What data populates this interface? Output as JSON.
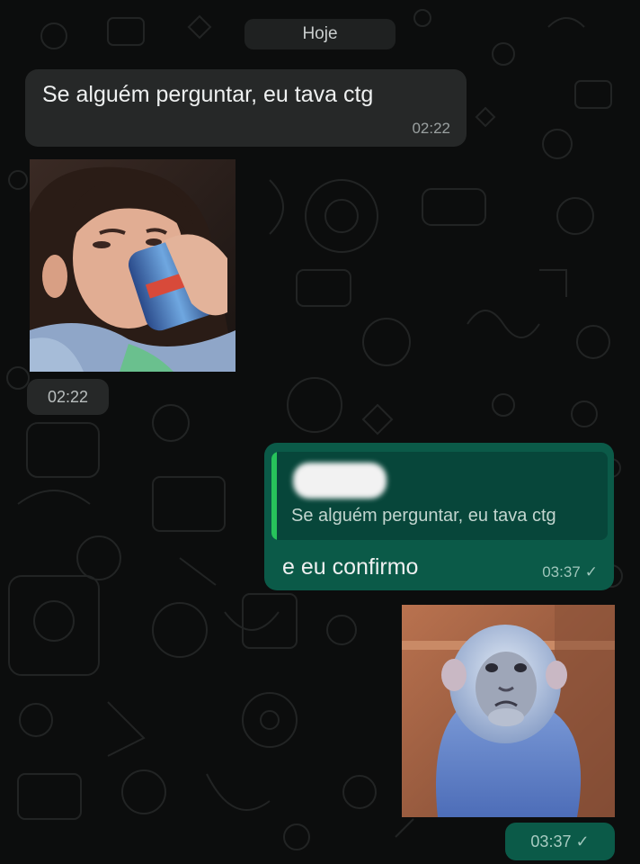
{
  "chat": {
    "date_separator": "Hoje",
    "messages": [
      {
        "direction": "incoming",
        "type": "text",
        "text": "Se alguém perguntar, eu tava ctg",
        "time": "02:22"
      },
      {
        "direction": "incoming",
        "type": "image",
        "time": "02:22"
      },
      {
        "direction": "outgoing",
        "type": "reply",
        "quoted_text": "Se alguém perguntar, eu tava ctg",
        "text": "e eu confirmo",
        "time": "03:37",
        "status_icon": "check-icon"
      },
      {
        "direction": "outgoing",
        "type": "image",
        "time": "03:37",
        "status_icon": "check-icon"
      }
    ]
  },
  "colors": {
    "background": "#0c0d0d",
    "incoming_bubble": "#262828",
    "outgoing_bubble": "#0b5a48",
    "quote_background": "#07463a",
    "quote_accent": "#27c35b"
  }
}
